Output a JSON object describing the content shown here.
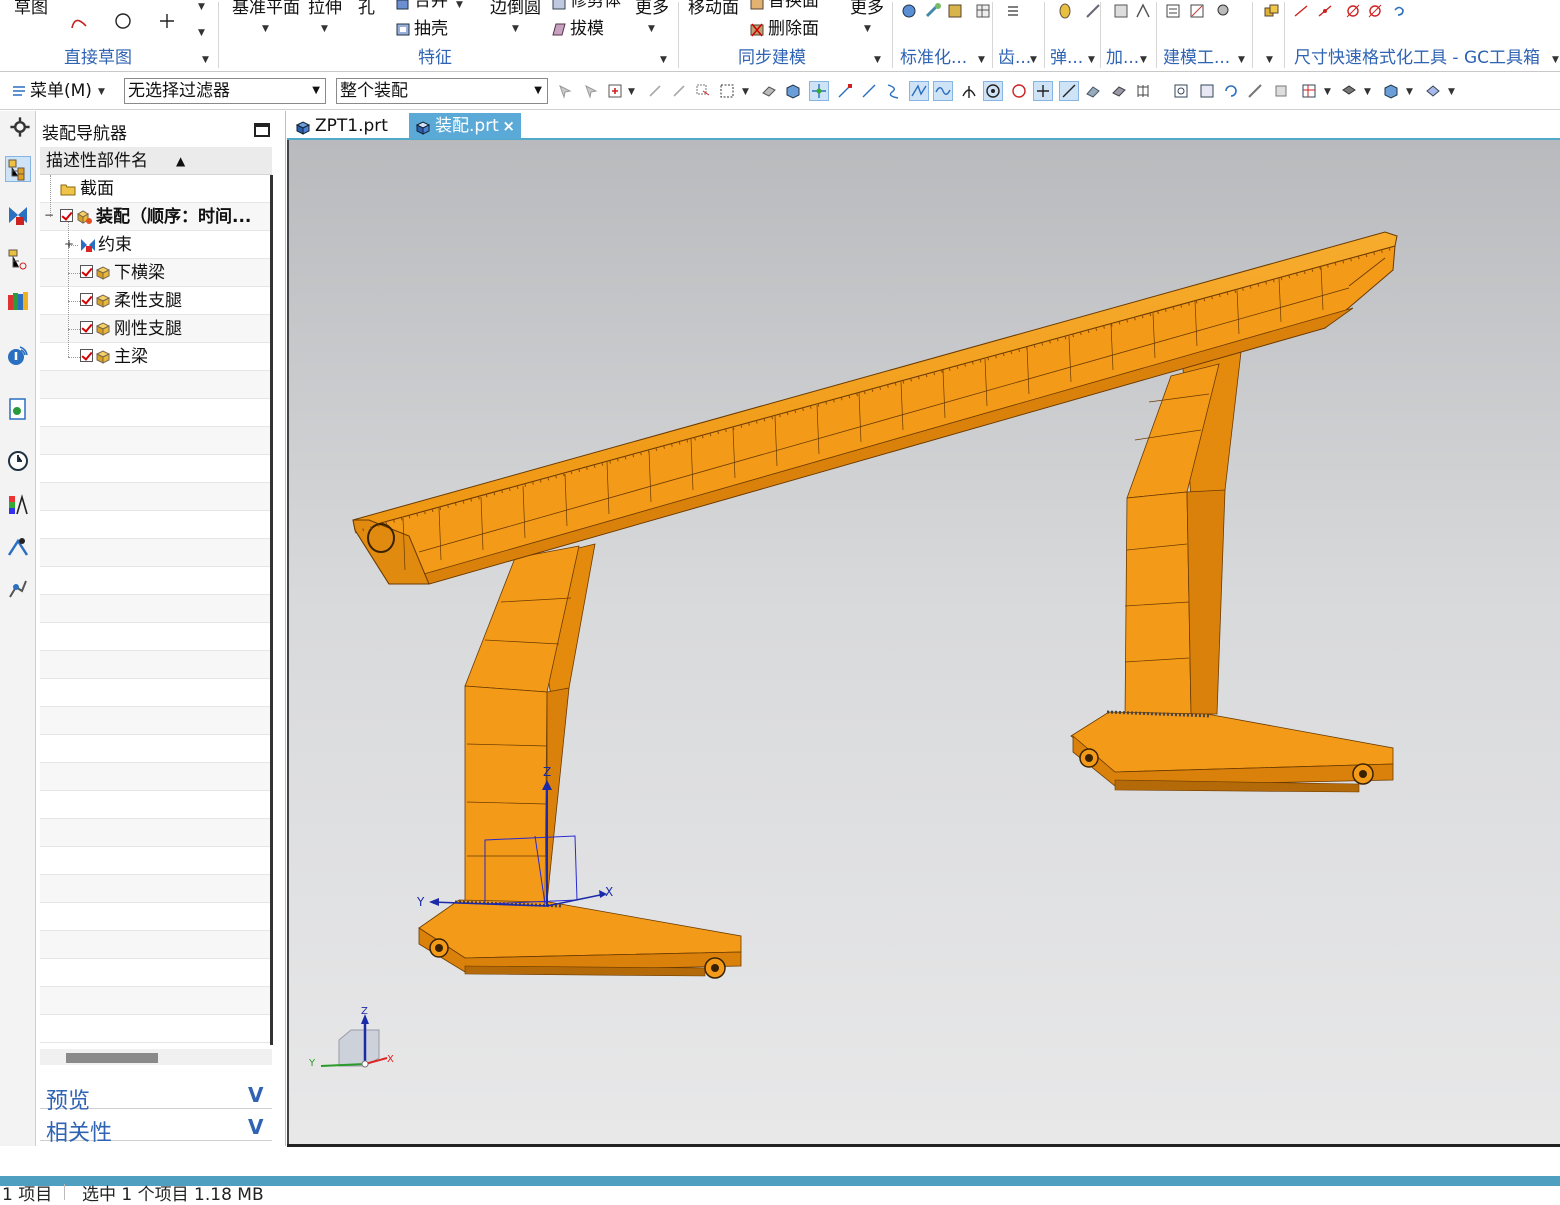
{
  "ribbon": {
    "sketch": "草图",
    "datum_plane": "基准平面",
    "extrude": "拉伸",
    "hole": "孔",
    "unite": "合并",
    "shell": "抽壳",
    "edge_blend": "边倒圆",
    "trim_body": "修剪体",
    "draft": "拔模",
    "more_1": "更多",
    "move_face": "移动面",
    "replace_face": "替换面",
    "delete_face": "删除面",
    "more_2": "更多",
    "groups": {
      "direct_sketch": "直接草图",
      "feature": "特征",
      "sync_modeling": "同步建模",
      "standardize": "标准化...",
      "gear": "齿...",
      "spring": "弹...",
      "add": "加...",
      "modeling_tools": "建模工...",
      "gc_toolkit": "尺寸快速格式化工具 - GC工具箱"
    }
  },
  "toolbar": {
    "menu": "菜单(M)",
    "filter": "无选择过滤器",
    "scope": "整个装配"
  },
  "navigator": {
    "title": "装配导航器",
    "column": "描述性部件名",
    "items": [
      {
        "label": "截面"
      },
      {
        "label": "装配（顺序：时间..."
      },
      {
        "label": "约束"
      },
      {
        "label": "下横梁"
      },
      {
        "label": "柔性支腿"
      },
      {
        "label": "刚性支腿"
      },
      {
        "label": "主梁"
      }
    ],
    "preview": "预览",
    "dependency": "相关性"
  },
  "tabs": [
    {
      "label": "ZPT1.prt"
    },
    {
      "label": "装配.prt"
    }
  ],
  "tab_close": "×",
  "viewport": {
    "axis_x": "X",
    "axis_y": "Y",
    "axis_z": "Z",
    "model_color": "#f0960f"
  },
  "status": {
    "left": "1 项目",
    "right": "选中 1 个项目  1.18 MB"
  }
}
